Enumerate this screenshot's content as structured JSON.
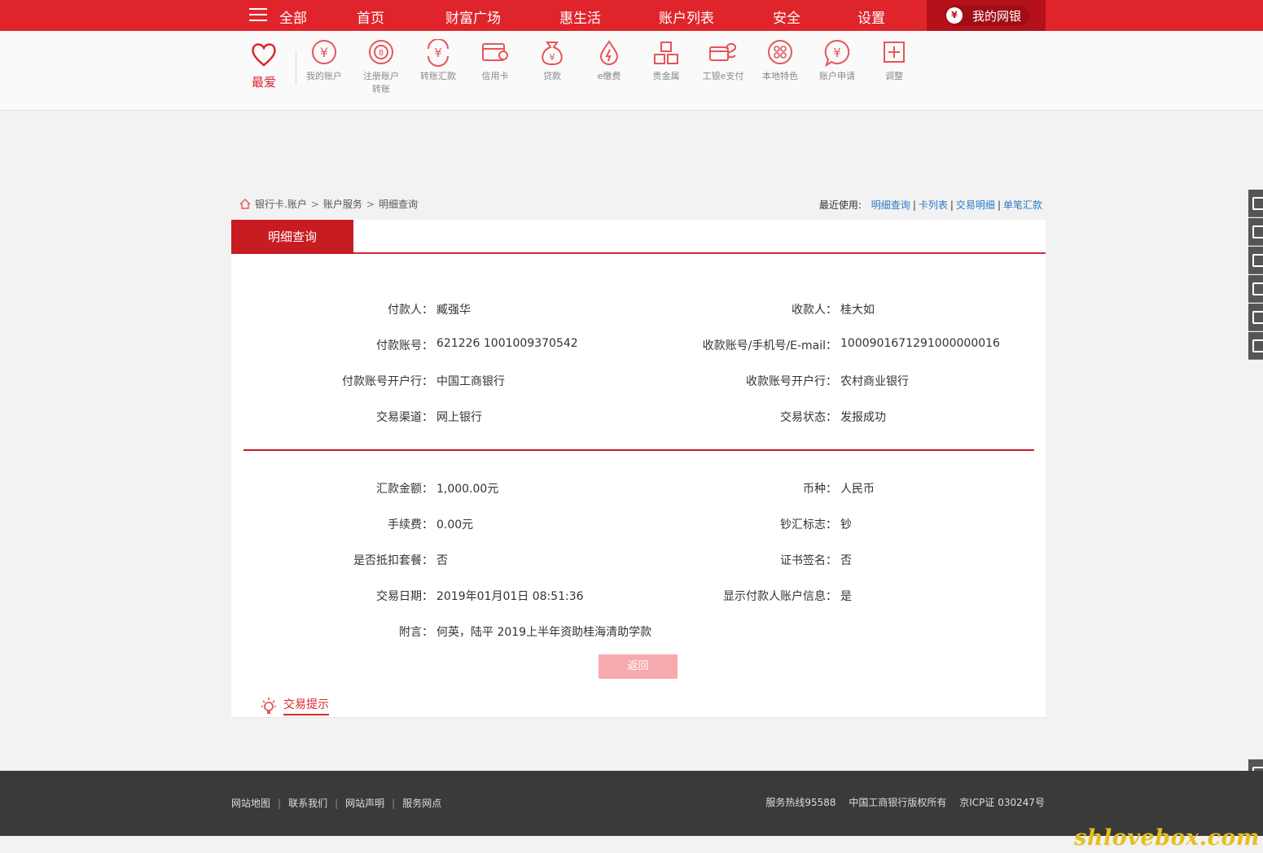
{
  "topnav": {
    "all": "全部",
    "items": [
      "首页",
      "财富广场",
      "惠生活",
      "账户列表",
      "安全",
      "设置"
    ],
    "mybank": "我的网银"
  },
  "iconbar": {
    "favorite": "最爱",
    "items": [
      {
        "label": "我的账户",
        "icon": "yuan-circle-icon"
      },
      {
        "label": "注册账户转账",
        "icon": "registered-transfer-icon"
      },
      {
        "label": "转账汇款",
        "icon": "transfer-icon"
      },
      {
        "label": "信用卡",
        "icon": "credit-card-icon"
      },
      {
        "label": "贷款",
        "icon": "loan-bag-icon"
      },
      {
        "label": "e缴费",
        "icon": "e-payment-icon"
      },
      {
        "label": "贵金属",
        "icon": "gold-bars-icon"
      },
      {
        "label": "工银e支付",
        "icon": "e-pay-icon"
      },
      {
        "label": "本地特色",
        "icon": "local-features-icon"
      },
      {
        "label": "账户申请",
        "icon": "account-apply-icon"
      },
      {
        "label": "调整",
        "icon": "plus-square-icon"
      }
    ]
  },
  "breadcrumb": [
    "银行卡.账户",
    "账户服务",
    "明细查询"
  ],
  "recent": {
    "label": "最近使用:",
    "links": [
      "明细查询",
      "卡列表",
      "交易明细",
      "单笔汇款"
    ]
  },
  "panel": {
    "tab": "明细查询",
    "section1": {
      "left": [
        {
          "k": "付款人：",
          "v": "臧强华"
        },
        {
          "k": "付款账号：",
          "v": "621226 1001009370542"
        },
        {
          "k": "付款账号开户行：",
          "v": "中国工商银行"
        },
        {
          "k": "交易渠道：",
          "v": "网上银行"
        }
      ],
      "right": [
        {
          "k": "收款人：",
          "v": "桂大如"
        },
        {
          "k": "收款账号/手机号/E-mail：",
          "v": "1000901671291000000016"
        },
        {
          "k": "收款账号开户行：",
          "v": "农村商业银行"
        },
        {
          "k": "交易状态：",
          "v": "发报成功"
        }
      ]
    },
    "section2": {
      "left": [
        {
          "k": "汇款金额：",
          "v": "1,000.00元"
        },
        {
          "k": "手续费：",
          "v": "0.00元"
        },
        {
          "k": "是否抵扣套餐：",
          "v": "否"
        },
        {
          "k": "交易日期：",
          "v": "2019年01月01日 08:51:36"
        },
        {
          "k": "附言：",
          "v": "何英，陆平 2019上半年资助桂海清助学款"
        }
      ],
      "right": [
        {
          "k": "币种：",
          "v": "人民币"
        },
        {
          "k": "钞汇标志：",
          "v": "钞"
        },
        {
          "k": "证书签名：",
          "v": "否"
        },
        {
          "k": "显示付款人账户信息：",
          "v": "是"
        }
      ]
    },
    "back_button": "返回",
    "tips": "交易提示"
  },
  "footer": {
    "links": [
      "网站地图",
      "联系我们",
      "网站声明",
      "服务网点"
    ],
    "hotline": "服务热线95588",
    "copyright": "中国工商银行版权所有",
    "icp": "京ICP证 030247号"
  },
  "watermark": "shlovebox.com",
  "colors": {
    "brand": "#e0242b",
    "tab": "#c81b22",
    "link": "#2a7bc6"
  }
}
